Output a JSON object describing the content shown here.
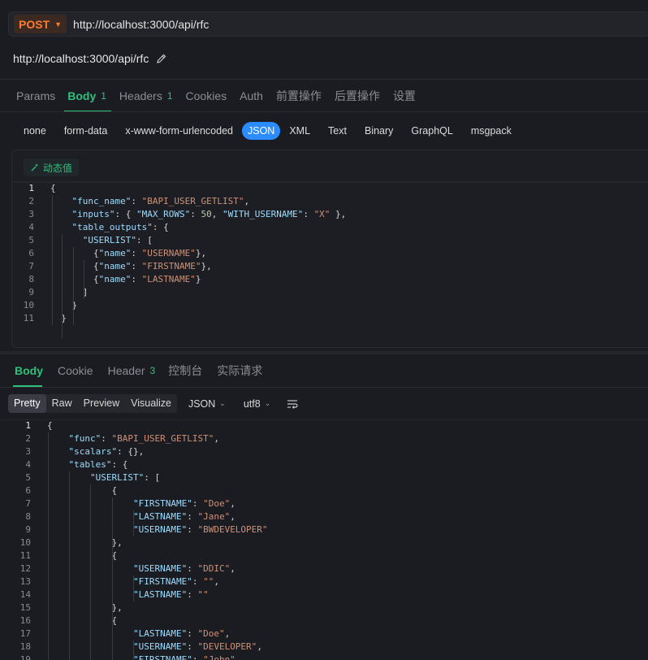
{
  "request": {
    "method": "POST",
    "url": "http://localhost:3000/api/rfc",
    "name": "http://localhost:3000/api/rfc"
  },
  "request_tabs": [
    {
      "label": "Params",
      "badge": ""
    },
    {
      "label": "Body",
      "badge": "1"
    },
    {
      "label": "Headers",
      "badge": "1"
    },
    {
      "label": "Cookies",
      "badge": ""
    },
    {
      "label": "Auth",
      "badge": ""
    },
    {
      "label": "前置操作",
      "badge": ""
    },
    {
      "label": "后置操作",
      "badge": ""
    },
    {
      "label": "设置",
      "badge": ""
    }
  ],
  "body_types": [
    "none",
    "form-data",
    "x-www-form-urlencoded",
    "JSON",
    "XML",
    "Text",
    "Binary",
    "GraphQL",
    "msgpack"
  ],
  "body_type_selected": "JSON",
  "dynamic_value_label": "动态值",
  "request_body_lines": [
    "{",
    "    \"func_name\": \"BAPI_USER_GETLIST\",",
    "    \"inputs\": { \"MAX_ROWS\": 50, \"WITH_USERNAME\": \"X\" },",
    "    \"table_outputs\": {",
    "      \"USERLIST\": [",
    "        {\"name\": \"USERNAME\"},",
    "        {\"name\": \"FIRSTNAME\"},",
    "        {\"name\": \"LASTNAME\"}",
    "      ]",
    "    }",
    "  }"
  ],
  "response_tabs": [
    {
      "label": "Body",
      "badge": ""
    },
    {
      "label": "Cookie",
      "badge": ""
    },
    {
      "label": "Header",
      "badge": "3"
    },
    {
      "label": "控制台",
      "badge": ""
    },
    {
      "label": "实际请求",
      "badge": ""
    }
  ],
  "response_view_modes": [
    "Pretty",
    "Raw",
    "Preview",
    "Visualize"
  ],
  "response_view_selected": "Pretty",
  "response_format": "JSON",
  "response_encoding": "utf8",
  "response_body_lines": [
    "{",
    "    \"func\": \"BAPI_USER_GETLIST\",",
    "    \"scalars\": {},",
    "    \"tables\": {",
    "        \"USERLIST\": [",
    "            {",
    "                \"FIRSTNAME\": \"Doe\",",
    "                \"LASTNAME\": \"Jane\",",
    "                \"USERNAME\": \"BWDEVELOPER\"",
    "            },",
    "            {",
    "                \"USERNAME\": \"DDIC\",",
    "                \"FIRSTNAME\": \"\",",
    "                \"LASTNAME\": \"\"",
    "            },",
    "            {",
    "                \"LASTNAME\": \"Doe\",",
    "                \"USERNAME\": \"DEVELOPER\",",
    "                \"FIRSTNAME\": \"John\""
  ],
  "colors": {
    "accent": "#2ec07b",
    "method": "#ff7a2e",
    "selected_chip": "#2b8cff",
    "json_key": "#9cdcfe",
    "json_string": "#ce9178",
    "json_number": "#b5cea8"
  }
}
